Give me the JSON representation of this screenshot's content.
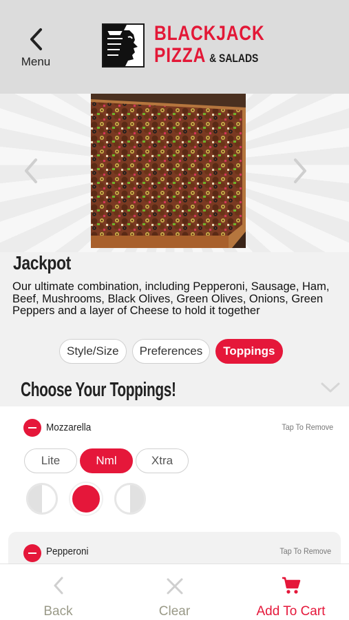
{
  "header": {
    "back_label": "Menu",
    "logo_line1": "BLACKJACK",
    "logo_line2": "PIZZA",
    "logo_line2_sub": "& SALADS"
  },
  "product": {
    "name": "Jackpot",
    "description": "Our ultimate combination, including Pepperoni, Sausage, Ham, Beef, Mushrooms, Black Olives, Green Olives, Onions, Green Peppers and a layer of Cheese to hold it together"
  },
  "tabs": [
    {
      "label": "Style/Size",
      "active": false
    },
    {
      "label": "Preferences",
      "active": false
    },
    {
      "label": "Toppings",
      "active": true
    }
  ],
  "section": {
    "title": "Choose Your Toppings!"
  },
  "toppings": [
    {
      "name": "Mozzarella",
      "remove_label": "Tap To Remove",
      "amounts": [
        "Lite",
        "Nml",
        "Xtra"
      ],
      "selected_amount": "Nml",
      "selected_portion": "whole"
    },
    {
      "name": "Pepperoni",
      "remove_label": "Tap To Remove"
    }
  ],
  "footer": {
    "back_label": "Back",
    "clear_label": "Clear",
    "cart_label": "Add To Cart"
  },
  "colors": {
    "accent": "#e5173a",
    "header_bg": "#dcdcdc",
    "muted": "#9a9a88"
  }
}
